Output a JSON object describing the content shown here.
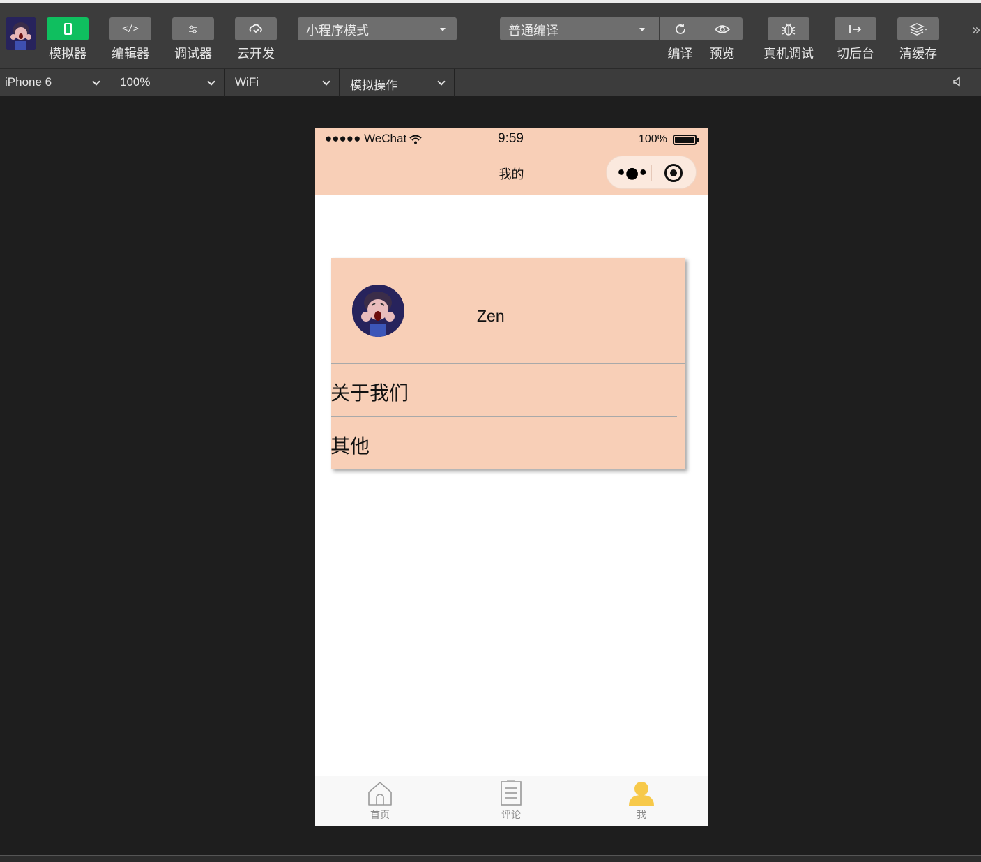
{
  "toolbar": {
    "buttons": [
      {
        "icon": "phone-icon",
        "label": "模拟器"
      },
      {
        "icon": "code-icon",
        "label": "编辑器"
      },
      {
        "icon": "sliders-icon",
        "label": "调试器"
      },
      {
        "icon": "cloud-link-icon",
        "label": "云开发"
      }
    ],
    "mode_select": "小程序模式",
    "compile_select": "普通编译",
    "actions": [
      {
        "icon": "refresh-icon",
        "label": "编译"
      },
      {
        "icon": "eye-icon",
        "label": "预览"
      },
      {
        "icon": "bug-icon",
        "label": "真机调试"
      },
      {
        "icon": "switch-icon",
        "label": "切后台"
      },
      {
        "icon": "layers-icon",
        "label": "清缓存"
      }
    ],
    "active_color": "#0fbf5f"
  },
  "subbar": {
    "device": "iPhone 6",
    "zoom": "100%",
    "network": "WiFi",
    "simulate": "模拟操作"
  },
  "phone": {
    "status": {
      "carrier": "●●●●● WeChat",
      "time": "9:59",
      "battery": "100%"
    },
    "nav_title": "我的",
    "theme_color": "#f8cfb7",
    "profile": {
      "username": "Zen"
    },
    "menu": [
      {
        "label": "关于我们"
      },
      {
        "label": "其他"
      }
    ],
    "tabs": [
      {
        "label": "首页",
        "icon": "home-icon",
        "active": false
      },
      {
        "label": "评论",
        "icon": "document-icon",
        "active": false
      },
      {
        "label": "我",
        "icon": "user-icon",
        "active": true
      }
    ],
    "tab_active_color": "#f7c94a"
  }
}
